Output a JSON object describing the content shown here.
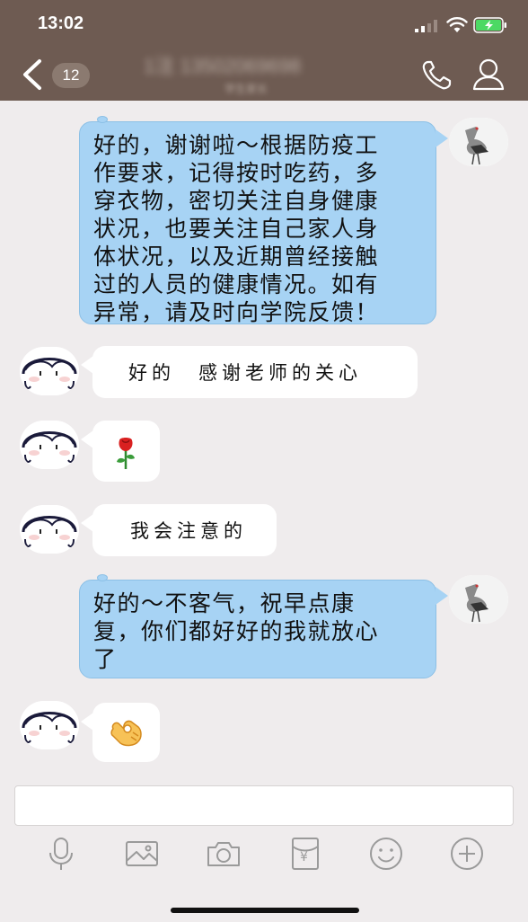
{
  "status_bar": {
    "time": "13:02"
  },
  "nav": {
    "unread_count": "12",
    "contact_name": "1注 13502069698",
    "contact_subtitle": "学生家长"
  },
  "messages": [
    {
      "side": "right",
      "type": "text",
      "text": "好的，谢谢啦～根据防疫工\n作要求，记得按时吃药，多\n穿衣物，密切关注自身健康\n状况，也要关注自己家人身\n体状况，以及近期曾经接触\n过的人员的健康情况。如有\n异常，请及时向学院反馈！"
    },
    {
      "side": "left",
      "type": "text",
      "text": "好的　感谢老师的关心"
    },
    {
      "side": "left",
      "type": "emoji",
      "icon": "rose-icon"
    },
    {
      "side": "left",
      "type": "text",
      "text": "我会注意的"
    },
    {
      "side": "right",
      "type": "text",
      "text": "好的～不客气，祝早点康\n复，你们都好好的我就放心\n了"
    },
    {
      "side": "left",
      "type": "emoji",
      "icon": "ok-hand-icon"
    }
  ],
  "toolbar": {
    "icons": [
      "microphone-icon",
      "image-icon",
      "camera-icon",
      "red-packet-icon",
      "emoji-icon",
      "plus-icon"
    ],
    "red_packet_symbol": "¥"
  },
  "colors": {
    "nav_background": "#6e5b52",
    "chat_background": "#efeced",
    "outgoing_bubble": "#a7d3f4",
    "incoming_bubble": "#ffffff",
    "battery_green": "#4cd964"
  }
}
